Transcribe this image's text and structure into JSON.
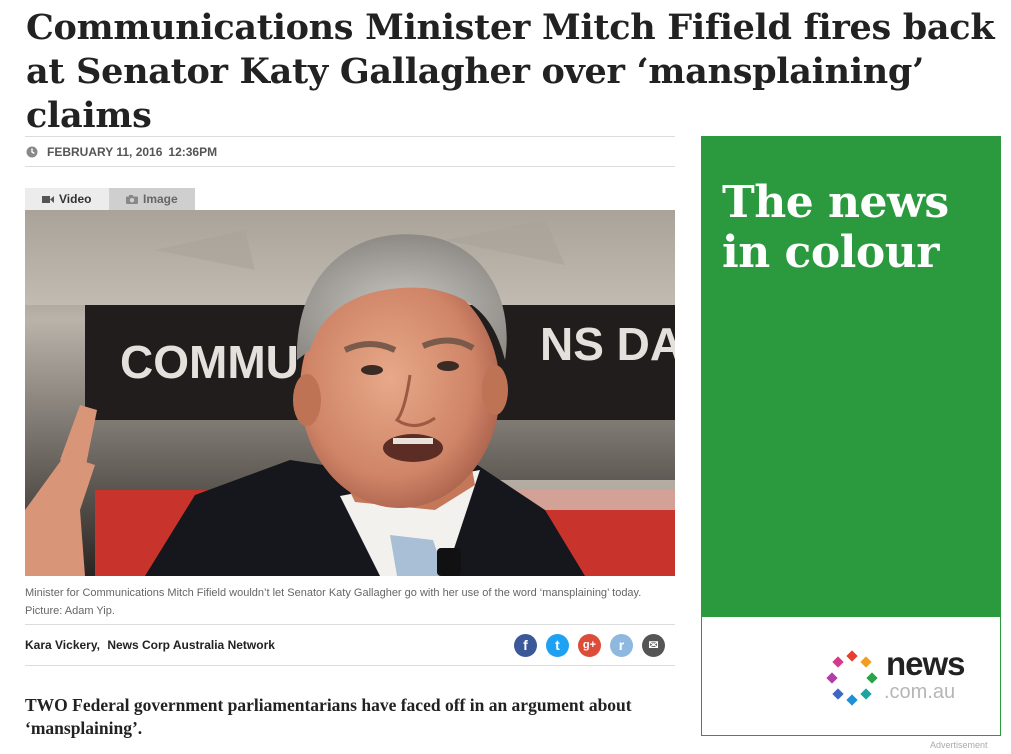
{
  "article": {
    "headline": "Communications Minister Mitch Fifield fires back at Senator Katy Gallagher over ‘mansplaining’ claims",
    "date": "FEBRUARY 11, 2016",
    "time": "12:36PM",
    "media_tabs": [
      {
        "label": "Video",
        "icon": "video-camera-icon"
      },
      {
        "label": "Image",
        "icon": "camera-icon"
      }
    ],
    "photo": {
      "backdrop_text": "COMMU",
      "backdrop_text_2": "NS DA"
    },
    "caption": "Minister for Communications Mitch Fifield wouldn’t let Senator Katy Gallagher go with her use of the word ‘mansplaining’ today. Picture: Adam Yip.",
    "author": "Kara Vickery",
    "outlet": "News Corp Australia Network",
    "share": [
      {
        "name": "facebook-icon",
        "glyph": "f",
        "color": "#3b5998"
      },
      {
        "name": "twitter-icon",
        "glyph": "t",
        "color": "#1da1f2"
      },
      {
        "name": "google-plus-icon",
        "glyph": "g+",
        "color": "#dd4b39"
      },
      {
        "name": "reddit-icon",
        "glyph": "r",
        "color": "#8fb8e0"
      },
      {
        "name": "email-icon",
        "glyph": "✉",
        "color": "#555555"
      }
    ],
    "lead": "TWO Federal government parliamentarians have faced off in an argument about ‘mansplaining’."
  },
  "advert": {
    "headline": "The news in colour",
    "brand": "news",
    "brand_domain": ".com.au",
    "label": "Advertisement",
    "green": "#2b9a3e"
  }
}
